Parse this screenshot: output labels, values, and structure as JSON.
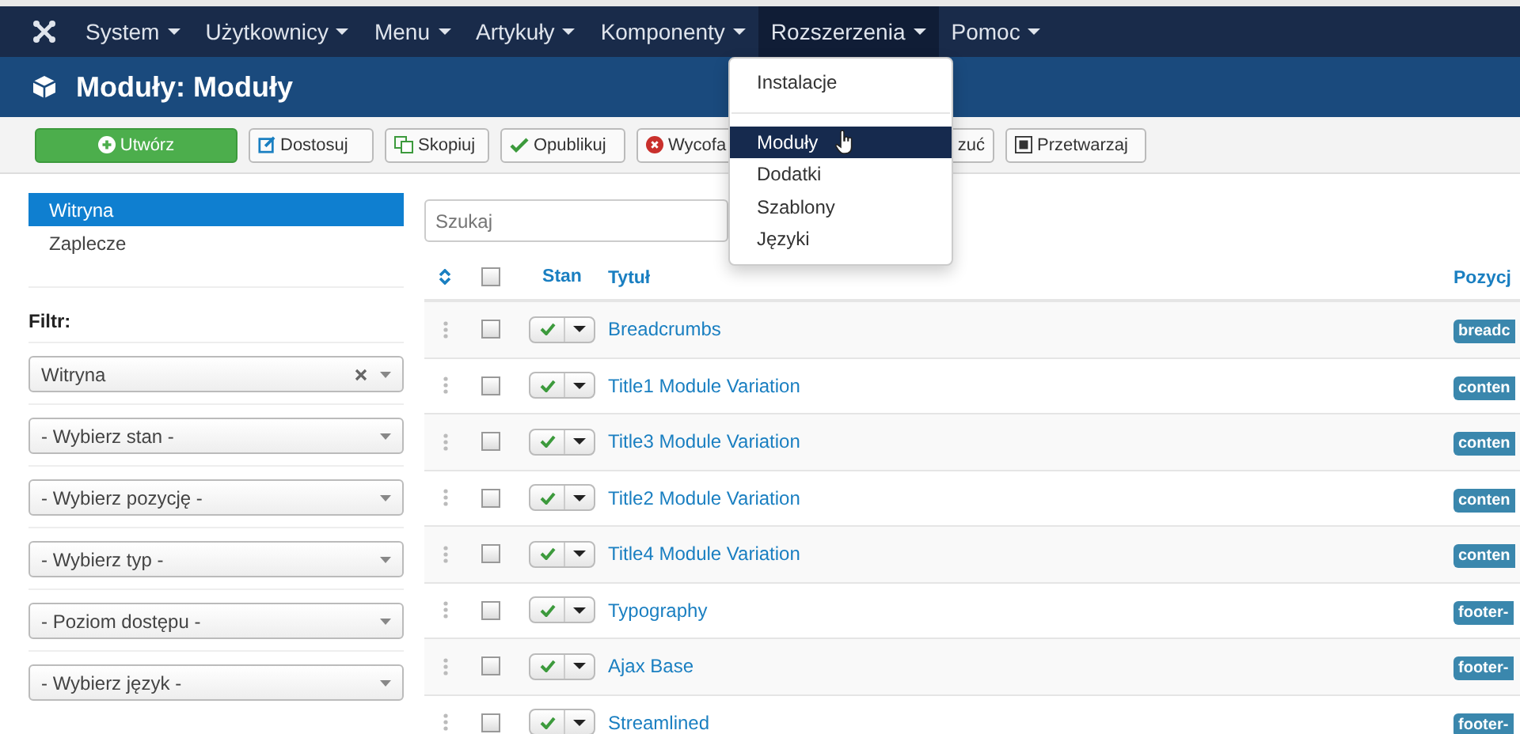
{
  "navbar": {
    "items": [
      {
        "label": "System",
        "selected": false
      },
      {
        "label": "Użytkownicy",
        "selected": false
      },
      {
        "label": "Menu",
        "selected": false
      },
      {
        "label": "Artykuły",
        "selected": false
      },
      {
        "label": "Komponenty",
        "selected": false
      },
      {
        "label": "Rozszerzenia",
        "selected": true
      },
      {
        "label": "Pomoc",
        "selected": false
      }
    ]
  },
  "dropdown": {
    "items": [
      {
        "label": "Instalacje",
        "selected": false,
        "divider_after": true
      },
      {
        "label": "Moduły",
        "selected": true,
        "divider_after": false
      },
      {
        "label": "Dodatki",
        "selected": false,
        "divider_after": false
      },
      {
        "label": "Szablony",
        "selected": false,
        "divider_after": false
      },
      {
        "label": "Języki",
        "selected": false,
        "divider_after": false
      }
    ]
  },
  "header": {
    "title": "Moduły: Moduły"
  },
  "toolbar": [
    {
      "label": "Utwórz",
      "kind": "new"
    },
    {
      "label": "Dostosuj",
      "kind": "edit"
    },
    {
      "label": "Skopiuj",
      "kind": "copy"
    },
    {
      "label": "Opublikuj",
      "kind": "publish"
    },
    {
      "label": "Wycofa",
      "kind": "unpublish"
    },
    {
      "label": "zuć",
      "kind": "hidden"
    },
    {
      "label": "Przetwarzaj",
      "kind": "batch"
    }
  ],
  "sidebar": {
    "items": [
      {
        "label": "Witryna",
        "selected": true
      },
      {
        "label": "Zaplecze",
        "selected": false
      }
    ],
    "filter_title": "Filtr:",
    "filters": [
      {
        "value": "Witryna",
        "clearable": true
      },
      {
        "value": "- Wybierz stan -",
        "clearable": false
      },
      {
        "value": "- Wybierz pozycję -",
        "clearable": false
      },
      {
        "value": "- Wybierz typ -",
        "clearable": false
      },
      {
        "value": "- Poziom dostępu -",
        "clearable": false
      },
      {
        "value": "- Wybierz język -",
        "clearable": false
      }
    ]
  },
  "search": {
    "placeholder": "Szukaj"
  },
  "table": {
    "all_checked": false,
    "columns": [
      "Stan",
      "Tytuł",
      "Pozycj"
    ],
    "rows": [
      {
        "title": "Breadcrumbs",
        "position": "breadc",
        "published": true,
        "checked": false
      },
      {
        "title": "Title1 Module Variation",
        "position": "conten",
        "published": true,
        "checked": false
      },
      {
        "title": "Title3 Module Variation",
        "position": "conten",
        "published": true,
        "checked": false
      },
      {
        "title": "Title2 Module Variation",
        "position": "conten",
        "published": true,
        "checked": false
      },
      {
        "title": "Title4 Module Variation",
        "position": "conten",
        "published": true,
        "checked": false
      },
      {
        "title": "Typography",
        "position": "footer-",
        "published": true,
        "checked": false
      },
      {
        "title": "Ajax Base",
        "position": "footer-",
        "published": true,
        "checked": false
      },
      {
        "title": "Streamlined",
        "position": "footer-",
        "published": true,
        "checked": false
      }
    ]
  }
}
